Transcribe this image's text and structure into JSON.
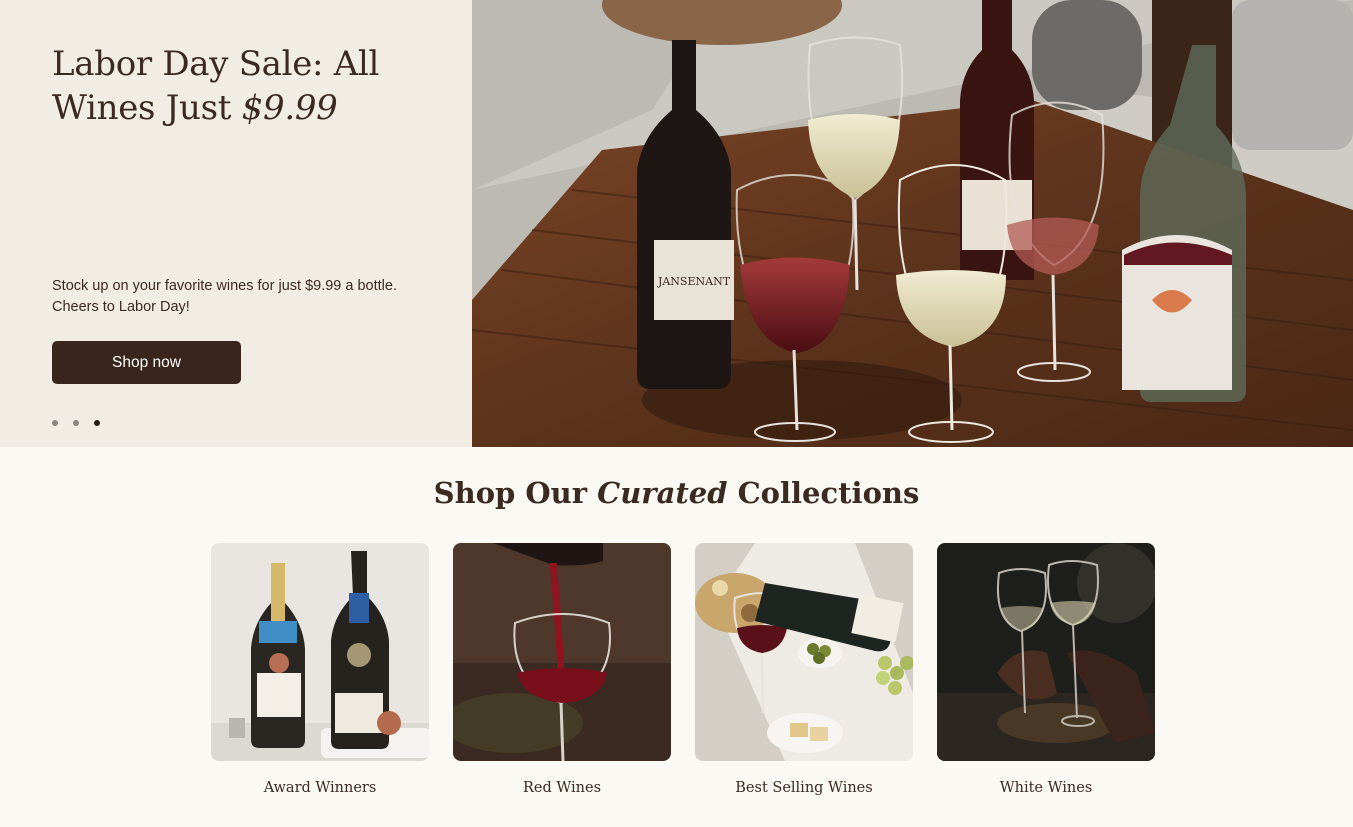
{
  "hero": {
    "title_main": "Labor Day Sale: All Wines Just ",
    "title_price": "$9.99",
    "description": "Stock up on your favorite wines for just $9.99 a bottle. Cheers to Labor Day!",
    "cta_label": "Shop now",
    "slide_count": 3,
    "active_slide": 3,
    "image_alt": "Wine bottles and glasses on a wooden table",
    "bottle_label_text": "JANSENANT"
  },
  "collections": {
    "title_pre": "Shop Our ",
    "title_em": "Curated",
    "title_post": " Collections",
    "items": [
      {
        "label": "Award Winners"
      },
      {
        "label": "Red Wines"
      },
      {
        "label": "Best Selling Wines"
      },
      {
        "label": "White Wines"
      }
    ]
  },
  "colors": {
    "brand_dark": "#3a251c",
    "hero_bg": "#f2ede4",
    "page_bg": "#fbf9f4"
  }
}
